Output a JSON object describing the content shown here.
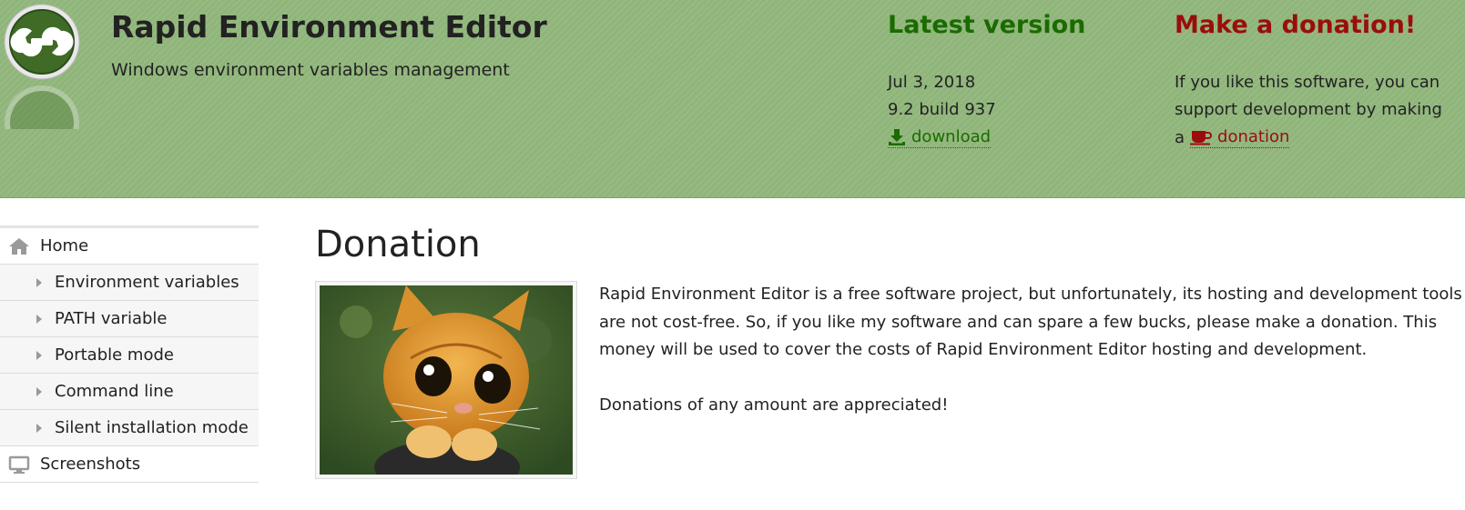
{
  "header": {
    "title": "Rapid Environment Editor",
    "subtitle": "Windows environment variables management",
    "logo_icon": "wrench-logo-icon"
  },
  "latest_version": {
    "heading": "Latest version",
    "date": "Jul 3, 2018",
    "build": "9.2 build 937",
    "download_label": "download",
    "download_icon": "download-icon"
  },
  "donation_box": {
    "heading": "Make a donation!",
    "line1": "If you like this software, you can",
    "line2": "support development by making",
    "line3_prefix": "a",
    "link_label": "donation",
    "link_icon": "coffee-cup-icon"
  },
  "sidebar": {
    "items": [
      {
        "label": "Home",
        "icon": "home-icon"
      },
      {
        "label": "Environment variables"
      },
      {
        "label": "PATH variable"
      },
      {
        "label": "Portable mode"
      },
      {
        "label": "Command line"
      },
      {
        "label": "Silent installation mode"
      },
      {
        "label": "Screenshots",
        "icon": "monitor-icon"
      }
    ]
  },
  "main": {
    "title": "Donation",
    "paragraph_lines": [
      "Rapid Environment Editor is a free software project, but unfortunately, its hosting and development tools",
      "are not cost-free. So, if you like my software and can spare a few bucks, please make a donation. This",
      "money will be used to cover the costs of Rapid Environment Editor hosting and development."
    ],
    "appreciation": "Donations of any amount are appreciated!"
  },
  "colors": {
    "header_bg": "#8fb57a",
    "latest_heading": "#1a6b00",
    "donate_heading": "#9b0d0d"
  }
}
